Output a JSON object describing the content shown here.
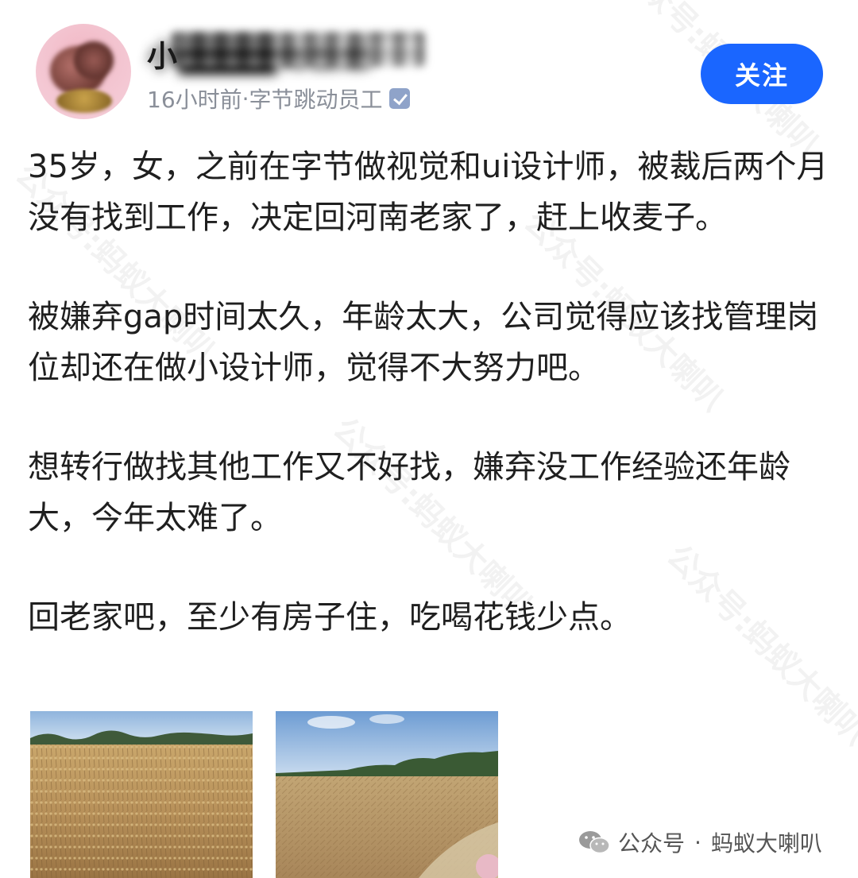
{
  "post": {
    "author_first_char": "小",
    "author_name": "小████有些惑",
    "time": "16小时前",
    "separator": "·",
    "author_tag": "字节跳动员工",
    "follow_label": "关注",
    "paragraphs": [
      "35岁，女，之前在字节做视觉和ui设计师，被裁后两个月没有找到工作，决定回河南老家了，赶上收麦子。",
      "被嫌弃gap时间太久，年龄太大，公司觉得应该找管理岗位却还在做小设计师，觉得不大努力吧。",
      "想转行做找其他工作又不好找，嫌弃没工作经验还年龄大，今年太难了。",
      "回老家吧，至少有房子住，吃喝花钱少点。"
    ]
  },
  "watermark": {
    "label": "公众号",
    "dot": "·",
    "account": "蚂蚁大喇叭",
    "tile_text": "公众号:蚂蚁大喇叭"
  },
  "colors": {
    "follow_button": "#1a66ff",
    "meta_text": "#8a8f99",
    "verified_badge": "#8fa3c9"
  },
  "icons": {
    "verified": "verified-badge-icon",
    "wechat": "wechat-icon"
  }
}
